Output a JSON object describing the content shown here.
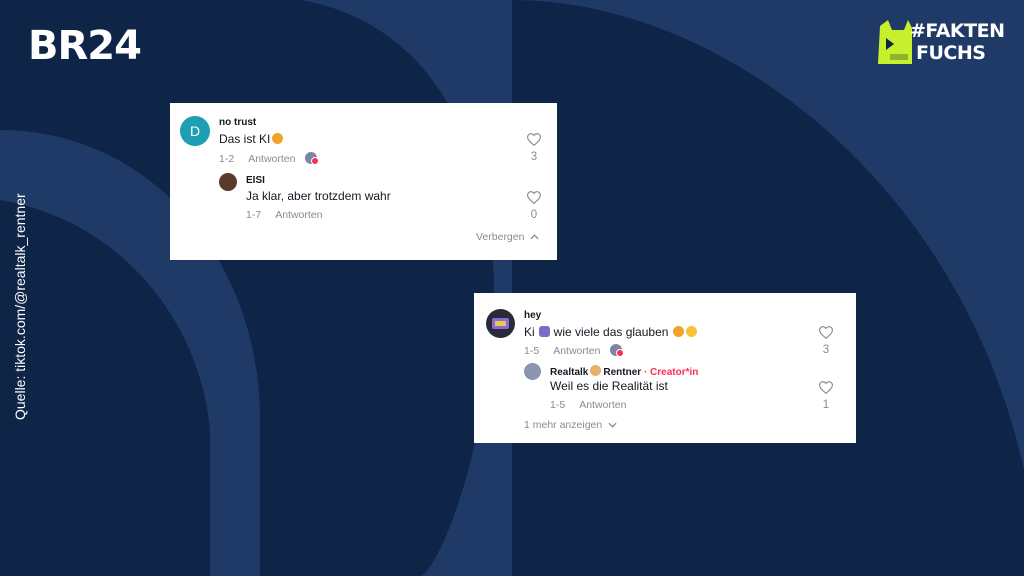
{
  "branding": {
    "br24_logo": "BR24",
    "faktenfuchs_line1": "#FAKTEN",
    "faktenfuchs_line2": "FUCHS"
  },
  "source": "Quelle: tiktok.com/@realtalk_rentner",
  "colors": {
    "background_light": "#1f3a66",
    "background_dark": "#0f2548",
    "faktenfuchs_accent": "#c6f02b",
    "creator_red": "#fe2c55"
  },
  "card1": {
    "comment": {
      "avatar_letter": "D",
      "username": "no trust",
      "text": "Das ist KI",
      "date": "1-2",
      "reply_label": "Antworten",
      "likes": "3"
    },
    "reply": {
      "username": "EISI",
      "text": "Ja klar, aber trotzdem wahr",
      "date": "1-7",
      "reply_label": "Antworten",
      "likes": "0"
    },
    "toggle_label": "Verbergen"
  },
  "card2": {
    "comment": {
      "username": "hey",
      "text_part1": "Ki",
      "text_part2": "wie viele das glauben",
      "date": "1-5",
      "reply_label": "Antworten",
      "likes": "3"
    },
    "reply": {
      "username": "Realtalk",
      "username_part2": "Rentner",
      "creator_label": "· Creator*in",
      "text": "Weil es die Realität ist",
      "date": "1-5",
      "reply_label": "Antworten",
      "likes": "1"
    },
    "toggle_label": "1 mehr anzeigen"
  }
}
